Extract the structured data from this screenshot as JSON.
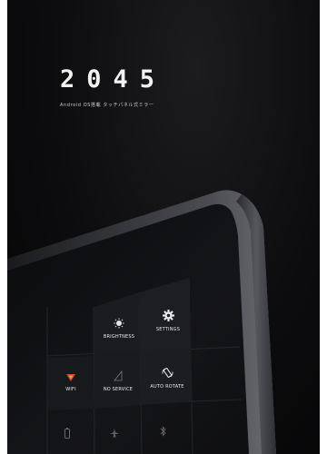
{
  "header": {
    "title": "2045",
    "subtitle": "Android OS搭載 タッチパネル式ミラー"
  },
  "panel": {
    "tiles": [
      {
        "label": "BRIGHTNESS",
        "icon": "brightness-icon"
      },
      {
        "label": "SETTINGS",
        "icon": "gear-icon"
      },
      {
        "label": "WIFI",
        "icon": "wifi-icon"
      },
      {
        "label": "NO SERVICE",
        "icon": "signal-icon"
      },
      {
        "label": "AUTO ROTATE",
        "icon": "rotate-icon"
      }
    ],
    "accent_color": "#d9452f"
  }
}
